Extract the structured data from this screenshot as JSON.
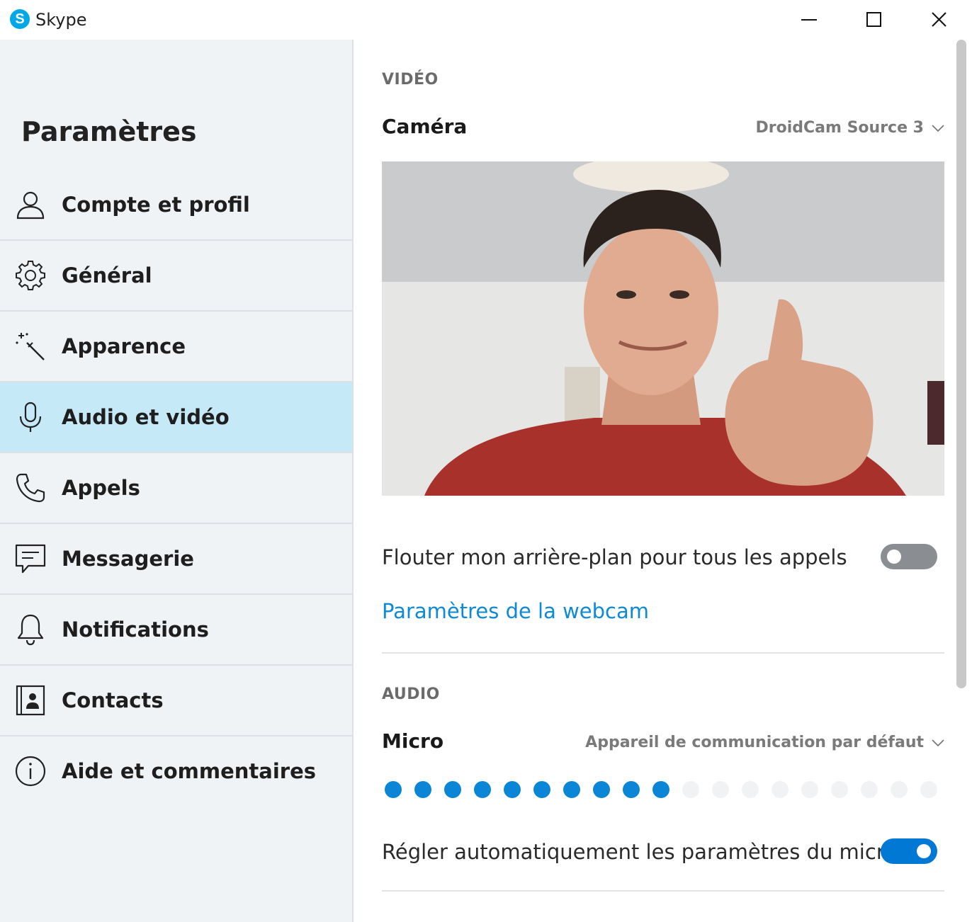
{
  "window": {
    "app_title": "Skype",
    "logo_letter": "S",
    "minimize_icon": "minimize-icon",
    "maximize_icon": "maximize-icon",
    "close_icon": "close-icon"
  },
  "sidebar": {
    "title": "Paramètres",
    "items": [
      {
        "label": "Compte et profil",
        "icon": "person-icon",
        "active": false
      },
      {
        "label": "Général",
        "icon": "gear-icon",
        "active": false
      },
      {
        "label": "Apparence",
        "icon": "magic-wand-icon",
        "active": false
      },
      {
        "label": "Audio et vidéo",
        "icon": "microphone-icon",
        "active": true
      },
      {
        "label": "Appels",
        "icon": "phone-icon",
        "active": false
      },
      {
        "label": "Messagerie",
        "icon": "message-icon",
        "active": false
      },
      {
        "label": "Notifications",
        "icon": "bell-icon",
        "active": false
      },
      {
        "label": "Contacts",
        "icon": "contact-card-icon",
        "active": false
      },
      {
        "label": "Aide et commentaires",
        "icon": "info-icon",
        "active": false
      }
    ]
  },
  "video": {
    "section_label": "VIDÉO",
    "camera_label": "Caméra",
    "camera_selected": "DroidCam Source 3",
    "blur_label": "Flouter mon arrière-plan pour tous les appels",
    "blur_enabled": false,
    "webcam_settings_link": "Paramètres de la webcam"
  },
  "audio": {
    "section_label": "AUDIO",
    "micro_label": "Micro",
    "micro_selected": "Appareil de communication par défaut",
    "mic_level_dots_total": 19,
    "mic_level_dots_lit": 10,
    "auto_adjust_label": "Régler automatiquement les paramètres du micro",
    "auto_adjust_enabled": true
  },
  "colors": {
    "accent": "#0078d4",
    "link": "#0d8ad6",
    "active_nav": "#c6e9f8",
    "sidebar_bg": "#f0f3f6"
  }
}
